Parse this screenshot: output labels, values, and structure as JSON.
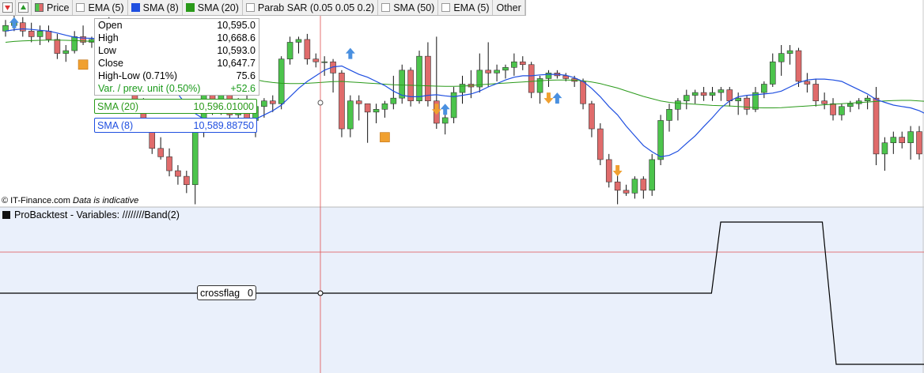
{
  "toolbar": {
    "items": [
      {
        "label": "Price",
        "swatch": "price"
      },
      {
        "label": "EMA (5)",
        "swatch": "none"
      },
      {
        "label": "SMA (8)",
        "swatch": "#1f4fe0"
      },
      {
        "label": "SMA (20)",
        "swatch": "#2a9a1a"
      },
      {
        "label": "Parab SAR (0.05 0.05 0.2)",
        "swatch": "none"
      },
      {
        "label": "SMA (50)",
        "swatch": "none"
      },
      {
        "label": "EMA (5)",
        "swatch": "none"
      },
      {
        "label": "Other",
        "swatch": ""
      }
    ]
  },
  "tooltip": {
    "open_label": "Open",
    "open_value": "10,595.0",
    "high_label": "High",
    "high_value": "10,668.6",
    "low_label": "Low",
    "low_value": "10,593.0",
    "close_label": "Close",
    "close_value": "10,647.7",
    "hl_label": "High-Low (0.71%)",
    "hl_value": "75.6",
    "var_label": "Var. / prev. unit (0.50%)",
    "var_value": "+52.6"
  },
  "sma20_box": {
    "label": "SMA (20)",
    "value": "10,596.01000"
  },
  "sma8_box": {
    "label": "SMA (8)",
    "value": "10,589.88750"
  },
  "copyright": {
    "source": "© IT-Finance.com",
    "note": "Data is indicative"
  },
  "pane2": {
    "title": "ProBacktest - Variables: ////////Band(2)",
    "flag_label": "crossflag",
    "flag_value": "0"
  },
  "colors": {
    "bull": "#4cc44c",
    "bear": "#e06b6b",
    "sma8": "#1f4fe0",
    "sma20": "#2a9a1a",
    "crosshair": "#e05050",
    "flag_line": "#000000",
    "signal_orange": "#f0a030",
    "signal_blue": "#4a90e0"
  },
  "chart_data": [
    {
      "type": "candlestick",
      "series_names": [
        "SMA (8)",
        "SMA (20)"
      ],
      "candles": [
        {
          "o": 60,
          "h": 64,
          "l": 58,
          "c": 62
        },
        {
          "o": 62,
          "h": 66,
          "l": 60,
          "c": 63
        },
        {
          "o": 63,
          "h": 65,
          "l": 58,
          "c": 60
        },
        {
          "o": 60,
          "h": 63,
          "l": 56,
          "c": 58
        },
        {
          "o": 58,
          "h": 62,
          "l": 55,
          "c": 60
        },
        {
          "o": 60,
          "h": 62,
          "l": 56,
          "c": 57
        },
        {
          "o": 57,
          "h": 59,
          "l": 50,
          "c": 52
        },
        {
          "o": 52,
          "h": 55,
          "l": 49,
          "c": 53
        },
        {
          "o": 53,
          "h": 60,
          "l": 52,
          "c": 58
        },
        {
          "o": 58,
          "h": 62,
          "l": 55,
          "c": 56
        },
        {
          "o": 56,
          "h": 58,
          "l": 54,
          "c": 57
        },
        {
          "o": 57,
          "h": 63,
          "l": 56,
          "c": 62
        },
        {
          "o": 62,
          "h": 65,
          "l": 58,
          "c": 60
        },
        {
          "o": 60,
          "h": 62,
          "l": 50,
          "c": 52
        },
        {
          "o": 52,
          "h": 53,
          "l": 40,
          "c": 42
        },
        {
          "o": 42,
          "h": 44,
          "l": 32,
          "c": 34
        },
        {
          "o": 34,
          "h": 36,
          "l": 24,
          "c": 26
        },
        {
          "o": 26,
          "h": 28,
          "l": 16,
          "c": 18
        },
        {
          "o": 18,
          "h": 22,
          "l": 14,
          "c": 15
        },
        {
          "o": 15,
          "h": 18,
          "l": 8,
          "c": 10
        },
        {
          "o": 10,
          "h": 12,
          "l": 5,
          "c": 8
        },
        {
          "o": 8,
          "h": 10,
          "l": 2,
          "c": 5
        },
        {
          "o": 5,
          "h": 28,
          "l": -2,
          "c": 26
        },
        {
          "o": 26,
          "h": 40,
          "l": 22,
          "c": 38
        },
        {
          "o": 38,
          "h": 42,
          "l": 30,
          "c": 33
        },
        {
          "o": 33,
          "h": 40,
          "l": 30,
          "c": 38
        },
        {
          "o": 38,
          "h": 44,
          "l": 26,
          "c": 30
        },
        {
          "o": 30,
          "h": 36,
          "l": 24,
          "c": 34
        },
        {
          "o": 34,
          "h": 38,
          "l": 25,
          "c": 28
        },
        {
          "o": 28,
          "h": 35,
          "l": 22,
          "c": 33
        },
        {
          "o": 33,
          "h": 36,
          "l": 29,
          "c": 35
        },
        {
          "o": 35,
          "h": 37,
          "l": 31,
          "c": 34
        },
        {
          "o": 34,
          "h": 51,
          "l": 32,
          "c": 50
        },
        {
          "o": 50,
          "h": 58,
          "l": 48,
          "c": 56
        },
        {
          "o": 56,
          "h": 58,
          "l": 52,
          "c": 57
        },
        {
          "o": 57,
          "h": 59,
          "l": 48,
          "c": 50
        },
        {
          "o": 50,
          "h": 52,
          "l": 47,
          "c": 49
        },
        {
          "o": 49,
          "h": 51,
          "l": 44,
          "c": 49
        },
        {
          "o": 49,
          "h": 50,
          "l": 38,
          "c": 45
        },
        {
          "o": 45,
          "h": 46,
          "l": 22,
          "c": 25
        },
        {
          "o": 25,
          "h": 37,
          "l": 22,
          "c": 35
        },
        {
          "o": 35,
          "h": 37,
          "l": 28,
          "c": 34
        },
        {
          "o": 34,
          "h": 34,
          "l": 20,
          "c": 31
        },
        {
          "o": 31,
          "h": 34,
          "l": 27,
          "c": 32
        },
        {
          "o": 32,
          "h": 35,
          "l": 29,
          "c": 34
        },
        {
          "o": 34,
          "h": 44,
          "l": 32,
          "c": 36
        },
        {
          "o": 36,
          "h": 48,
          "l": 34,
          "c": 46
        },
        {
          "o": 46,
          "h": 47,
          "l": 33,
          "c": 35
        },
        {
          "o": 35,
          "h": 53,
          "l": 34,
          "c": 51
        },
        {
          "o": 51,
          "h": 56,
          "l": 33,
          "c": 35
        },
        {
          "o": 35,
          "h": 58,
          "l": 25,
          "c": 27
        },
        {
          "o": 27,
          "h": 32,
          "l": 23,
          "c": 29
        },
        {
          "o": 29,
          "h": 40,
          "l": 27,
          "c": 38
        },
        {
          "o": 38,
          "h": 44,
          "l": 34,
          "c": 41
        },
        {
          "o": 41,
          "h": 46,
          "l": 36,
          "c": 40
        },
        {
          "o": 40,
          "h": 52,
          "l": 38,
          "c": 46
        },
        {
          "o": 46,
          "h": 56,
          "l": 40,
          "c": 45
        },
        {
          "o": 45,
          "h": 48,
          "l": 42,
          "c": 46
        },
        {
          "o": 46,
          "h": 48,
          "l": 43,
          "c": 47
        },
        {
          "o": 47,
          "h": 52,
          "l": 44,
          "c": 49
        },
        {
          "o": 49,
          "h": 51,
          "l": 46,
          "c": 48
        },
        {
          "o": 48,
          "h": 49,
          "l": 36,
          "c": 38
        },
        {
          "o": 38,
          "h": 44,
          "l": 34,
          "c": 43
        },
        {
          "o": 43,
          "h": 46,
          "l": 40,
          "c": 45
        },
        {
          "o": 45,
          "h": 46,
          "l": 43,
          "c": 44
        },
        {
          "o": 44,
          "h": 45,
          "l": 42,
          "c": 43
        },
        {
          "o": 43,
          "h": 44,
          "l": 40,
          "c": 42
        },
        {
          "o": 42,
          "h": 43,
          "l": 32,
          "c": 34
        },
        {
          "o": 34,
          "h": 35,
          "l": 22,
          "c": 25
        },
        {
          "o": 25,
          "h": 27,
          "l": 12,
          "c": 14
        },
        {
          "o": 14,
          "h": 16,
          "l": 4,
          "c": 6
        },
        {
          "o": 6,
          "h": 9,
          "l": -2,
          "c": 3
        },
        {
          "o": 3,
          "h": 5,
          "l": 1,
          "c": 2
        },
        {
          "o": 2,
          "h": 8,
          "l": 0,
          "c": 7
        },
        {
          "o": 7,
          "h": 8,
          "l": 0,
          "c": 3
        },
        {
          "o": 3,
          "h": 16,
          "l": 1,
          "c": 14
        },
        {
          "o": 14,
          "h": 30,
          "l": 12,
          "c": 28
        },
        {
          "o": 28,
          "h": 34,
          "l": 24,
          "c": 32
        },
        {
          "o": 32,
          "h": 36,
          "l": 28,
          "c": 35
        },
        {
          "o": 35,
          "h": 39,
          "l": 32,
          "c": 37
        },
        {
          "o": 37,
          "h": 39,
          "l": 34,
          "c": 38
        },
        {
          "o": 38,
          "h": 40,
          "l": 35,
          "c": 37
        },
        {
          "o": 37,
          "h": 40,
          "l": 35,
          "c": 38
        },
        {
          "o": 38,
          "h": 40,
          "l": 35,
          "c": 39
        },
        {
          "o": 39,
          "h": 40,
          "l": 33,
          "c": 35
        },
        {
          "o": 35,
          "h": 38,
          "l": 30,
          "c": 36
        },
        {
          "o": 36,
          "h": 37,
          "l": 30,
          "c": 32
        },
        {
          "o": 32,
          "h": 40,
          "l": 31,
          "c": 38
        },
        {
          "o": 38,
          "h": 42,
          "l": 36,
          "c": 41
        },
        {
          "o": 41,
          "h": 52,
          "l": 40,
          "c": 49
        },
        {
          "o": 49,
          "h": 55,
          "l": 44,
          "c": 52
        },
        {
          "o": 52,
          "h": 55,
          "l": 48,
          "c": 53
        },
        {
          "o": 53,
          "h": 54,
          "l": 40,
          "c": 42
        },
        {
          "o": 42,
          "h": 45,
          "l": 38,
          "c": 41
        },
        {
          "o": 41,
          "h": 43,
          "l": 33,
          "c": 35
        },
        {
          "o": 35,
          "h": 38,
          "l": 32,
          "c": 34
        },
        {
          "o": 34,
          "h": 36,
          "l": 28,
          "c": 30
        },
        {
          "o": 30,
          "h": 34,
          "l": 28,
          "c": 33
        },
        {
          "o": 33,
          "h": 35,
          "l": 31,
          "c": 34
        },
        {
          "o": 34,
          "h": 36,
          "l": 32,
          "c": 35
        },
        {
          "o": 35,
          "h": 37,
          "l": 32,
          "c": 36
        },
        {
          "o": 36,
          "h": 40,
          "l": 12,
          "c": 16
        },
        {
          "o": 16,
          "h": 22,
          "l": 10,
          "c": 20
        },
        {
          "o": 20,
          "h": 24,
          "l": 16,
          "c": 22
        },
        {
          "o": 22,
          "h": 24,
          "l": 18,
          "c": 20
        },
        {
          "o": 20,
          "h": 26,
          "l": 14,
          "c": 24
        },
        {
          "o": 24,
          "h": 26,
          "l": 14,
          "c": 16
        }
      ],
      "sma8": [
        60,
        60.5,
        60.8,
        60.6,
        60.3,
        60,
        59.3,
        58.5,
        57.8,
        57.5,
        57.4,
        57.3,
        57.5,
        57.3,
        56,
        54,
        51.5,
        48.5,
        45,
        41.5,
        37.5,
        33.5,
        30.5,
        28.5,
        27,
        26,
        25.5,
        26,
        26.5,
        28.5,
        30,
        31.5,
        33.5,
        36.5,
        39.5,
        42,
        44,
        46,
        47.2,
        47.5,
        46,
        44.5,
        43.5,
        42,
        40.5,
        38.5,
        37,
        36.5,
        36.5,
        37,
        37.2,
        36.8,
        36.5,
        37,
        37.5,
        38.5,
        40,
        41.2,
        42.5,
        43.5,
        44,
        44,
        44.3,
        44.5,
        44.5,
        44.2,
        43.3,
        42,
        39.5,
        36.5,
        33,
        30,
        26,
        22.5,
        19,
        16.8,
        15,
        15.5,
        17,
        19.8,
        22.5,
        25.8,
        29,
        32.5,
        35,
        36.5,
        37,
        37.2,
        37.5,
        37.8,
        38.5,
        40,
        41.5,
        42.5,
        42.8,
        42.8,
        42.5,
        42,
        40.5,
        39,
        37.5,
        35.5,
        34.5,
        33.5,
        33,
        32.5,
        31.5,
        30,
        28,
        26.5
      ],
      "sma20": [
        56,
        56.3,
        56.5,
        56.6,
        56.7,
        56.8,
        56.8,
        56.7,
        56.6,
        56.5,
        56.3,
        56.1,
        55.9,
        55.7,
        55.3,
        54.7,
        53.8,
        52.8,
        51.6,
        50.5,
        49.2,
        48,
        46.9,
        46,
        45.3,
        44.8,
        44.3,
        43.8,
        43.2,
        42.6,
        42,
        41.6,
        41.3,
        41.2,
        41.2,
        41.3,
        41.5,
        41.7,
        41.9,
        42,
        41.8,
        41.6,
        41.4,
        41.2,
        41,
        40.8,
        40.7,
        40.6,
        40.5,
        40.4,
        40.3,
        40.2,
        40.2,
        40.3,
        40.5,
        40.8,
        41,
        41.2,
        41.4,
        41.6,
        41.8,
        42,
        42.2,
        42.4,
        42.5,
        42.5,
        42.4,
        42.2,
        41.8,
        41.2,
        40.4,
        39.6,
        38.6,
        37.6,
        36.6,
        35.8,
        35,
        34.5,
        34.2,
        34,
        33.8,
        33.6,
        33.4,
        33.3,
        33.2,
        33,
        32.8,
        32.6,
        32.5,
        32.5,
        32.6,
        32.8,
        33,
        33.2,
        33.4,
        33.6,
        33.8,
        34,
        34.2,
        34.4,
        34.6,
        34.8,
        35,
        35.1,
        35.2,
        35.2,
        35,
        34.8,
        34.6,
        34.3
      ]
    },
    {
      "type": "line",
      "series_names": [
        "crossflag"
      ],
      "segments": [
        {
          "from": 0,
          "to": 0.77,
          "value": 0
        },
        {
          "from": 0.78,
          "to": 0.89,
          "value": 1
        },
        {
          "from": 0.905,
          "to": 1.0,
          "value": -1
        }
      ]
    }
  ]
}
